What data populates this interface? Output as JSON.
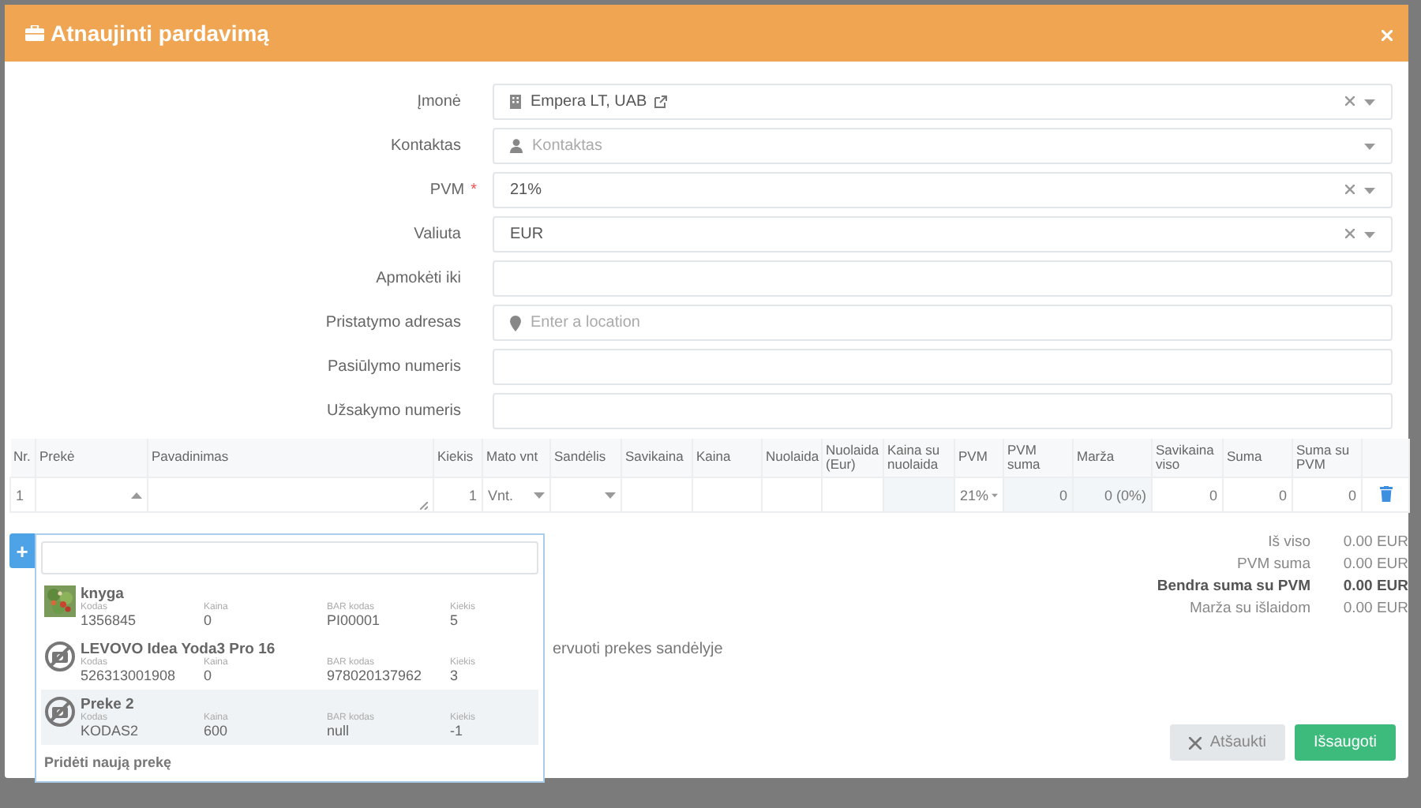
{
  "dialog": {
    "title": "Atnaujinti pardavimą"
  },
  "form": [
    {
      "label": "Įmonė",
      "kind": "company",
      "value": "Empera LT, UAB",
      "clearable": true
    },
    {
      "label": "Kontaktas",
      "kind": "contact",
      "placeholder": "Kontaktas",
      "clearable": false
    },
    {
      "label": "PVM",
      "kind": "select",
      "value": "21%",
      "clearable": true,
      "required_mark": "*"
    },
    {
      "label": "Valiuta",
      "kind": "select",
      "value": "EUR",
      "clearable": true
    },
    {
      "label": "Apmokėti iki",
      "kind": "text"
    },
    {
      "label": "Pristatymo adresas",
      "kind": "location",
      "placeholder": "Enter a location"
    },
    {
      "label": "Pasiūlymo numeris",
      "kind": "text"
    },
    {
      "label": "Užsakymo numeris",
      "kind": "text"
    }
  ],
  "table": {
    "columns": [
      "Nr.",
      "Prekė",
      "Pavadinimas",
      "Kiekis",
      "Mato vnt",
      "Sandėlis",
      "Savikaina",
      "Kaina",
      "Nuolaida",
      "Nuolaida (Eur)",
      "Kaina su nuolaida",
      "PVM",
      "PVM suma",
      "Marža",
      "Savikaina viso",
      "Suma",
      "Suma su PVM"
    ],
    "rows": [
      [
        {
          "kind": "index",
          "value": "1"
        },
        {
          "kind": "combo",
          "expanded": true
        },
        {
          "kind": "textarea"
        },
        {
          "kind": "number",
          "value": "1"
        },
        {
          "kind": "select",
          "value": "Vnt."
        },
        {
          "kind": "select"
        },
        {
          "kind": "input"
        },
        {
          "kind": "input"
        },
        {
          "kind": "input"
        },
        {
          "kind": "input"
        },
        {
          "kind": "readonly"
        },
        {
          "kind": "select",
          "value": "21%"
        },
        {
          "kind": "readonly",
          "value": "0"
        },
        {
          "kind": "readonly",
          "value": "0 (0%)"
        },
        {
          "kind": "number",
          "value": "0"
        },
        {
          "kind": "number",
          "value": "0"
        },
        {
          "kind": "number",
          "value": "0"
        },
        {
          "kind": "delete"
        }
      ]
    ]
  },
  "add_button": "+",
  "reserve_note": "ervuoti prekes sandėlyje",
  "totals": [
    {
      "label": "Iš viso",
      "value": "0.00 EUR",
      "bold": false
    },
    {
      "label": "PVM suma",
      "value": "0.00 EUR",
      "bold": false
    },
    {
      "label": "Bendra suma su PVM",
      "value": "0.00 EUR",
      "bold": true
    },
    {
      "label": "Marža su išlaidom",
      "value": "0.00 EUR",
      "bold": false
    }
  ],
  "buttons": [
    {
      "kind": "cancel",
      "label": "Atšaukti"
    },
    {
      "kind": "save",
      "label": "Išsaugoti"
    }
  ],
  "product_dropdown": {
    "items": [
      {
        "name": "knyga",
        "kind": "picture",
        "selected": false,
        "fields": [
          {
            "label": "Kodas",
            "value": "1356845"
          },
          {
            "label": "Kaina",
            "value": "0"
          },
          {
            "label": "BAR kodas",
            "value": "PI00001"
          },
          {
            "label": "Kiekis",
            "value": "5"
          }
        ]
      },
      {
        "name": "LEVOVO Idea Yoda3 Pro 16",
        "kind": "no-image",
        "selected": false,
        "fields": [
          {
            "label": "Kodas",
            "value": "526313001908"
          },
          {
            "label": "Kaina",
            "value": "0"
          },
          {
            "label": "BAR kodas",
            "value": "978020137962"
          },
          {
            "label": "Kiekis",
            "value": "3"
          }
        ]
      },
      {
        "name": "Preke 2",
        "kind": "no-image",
        "selected": true,
        "fields": [
          {
            "label": "Kodas",
            "value": "KODAS2"
          },
          {
            "label": "Kaina",
            "value": "600"
          },
          {
            "label": "BAR kodas",
            "value": "null"
          },
          {
            "label": "Kiekis",
            "value": "-1"
          }
        ]
      }
    ],
    "footer": "Pridėti naują prekę"
  }
}
